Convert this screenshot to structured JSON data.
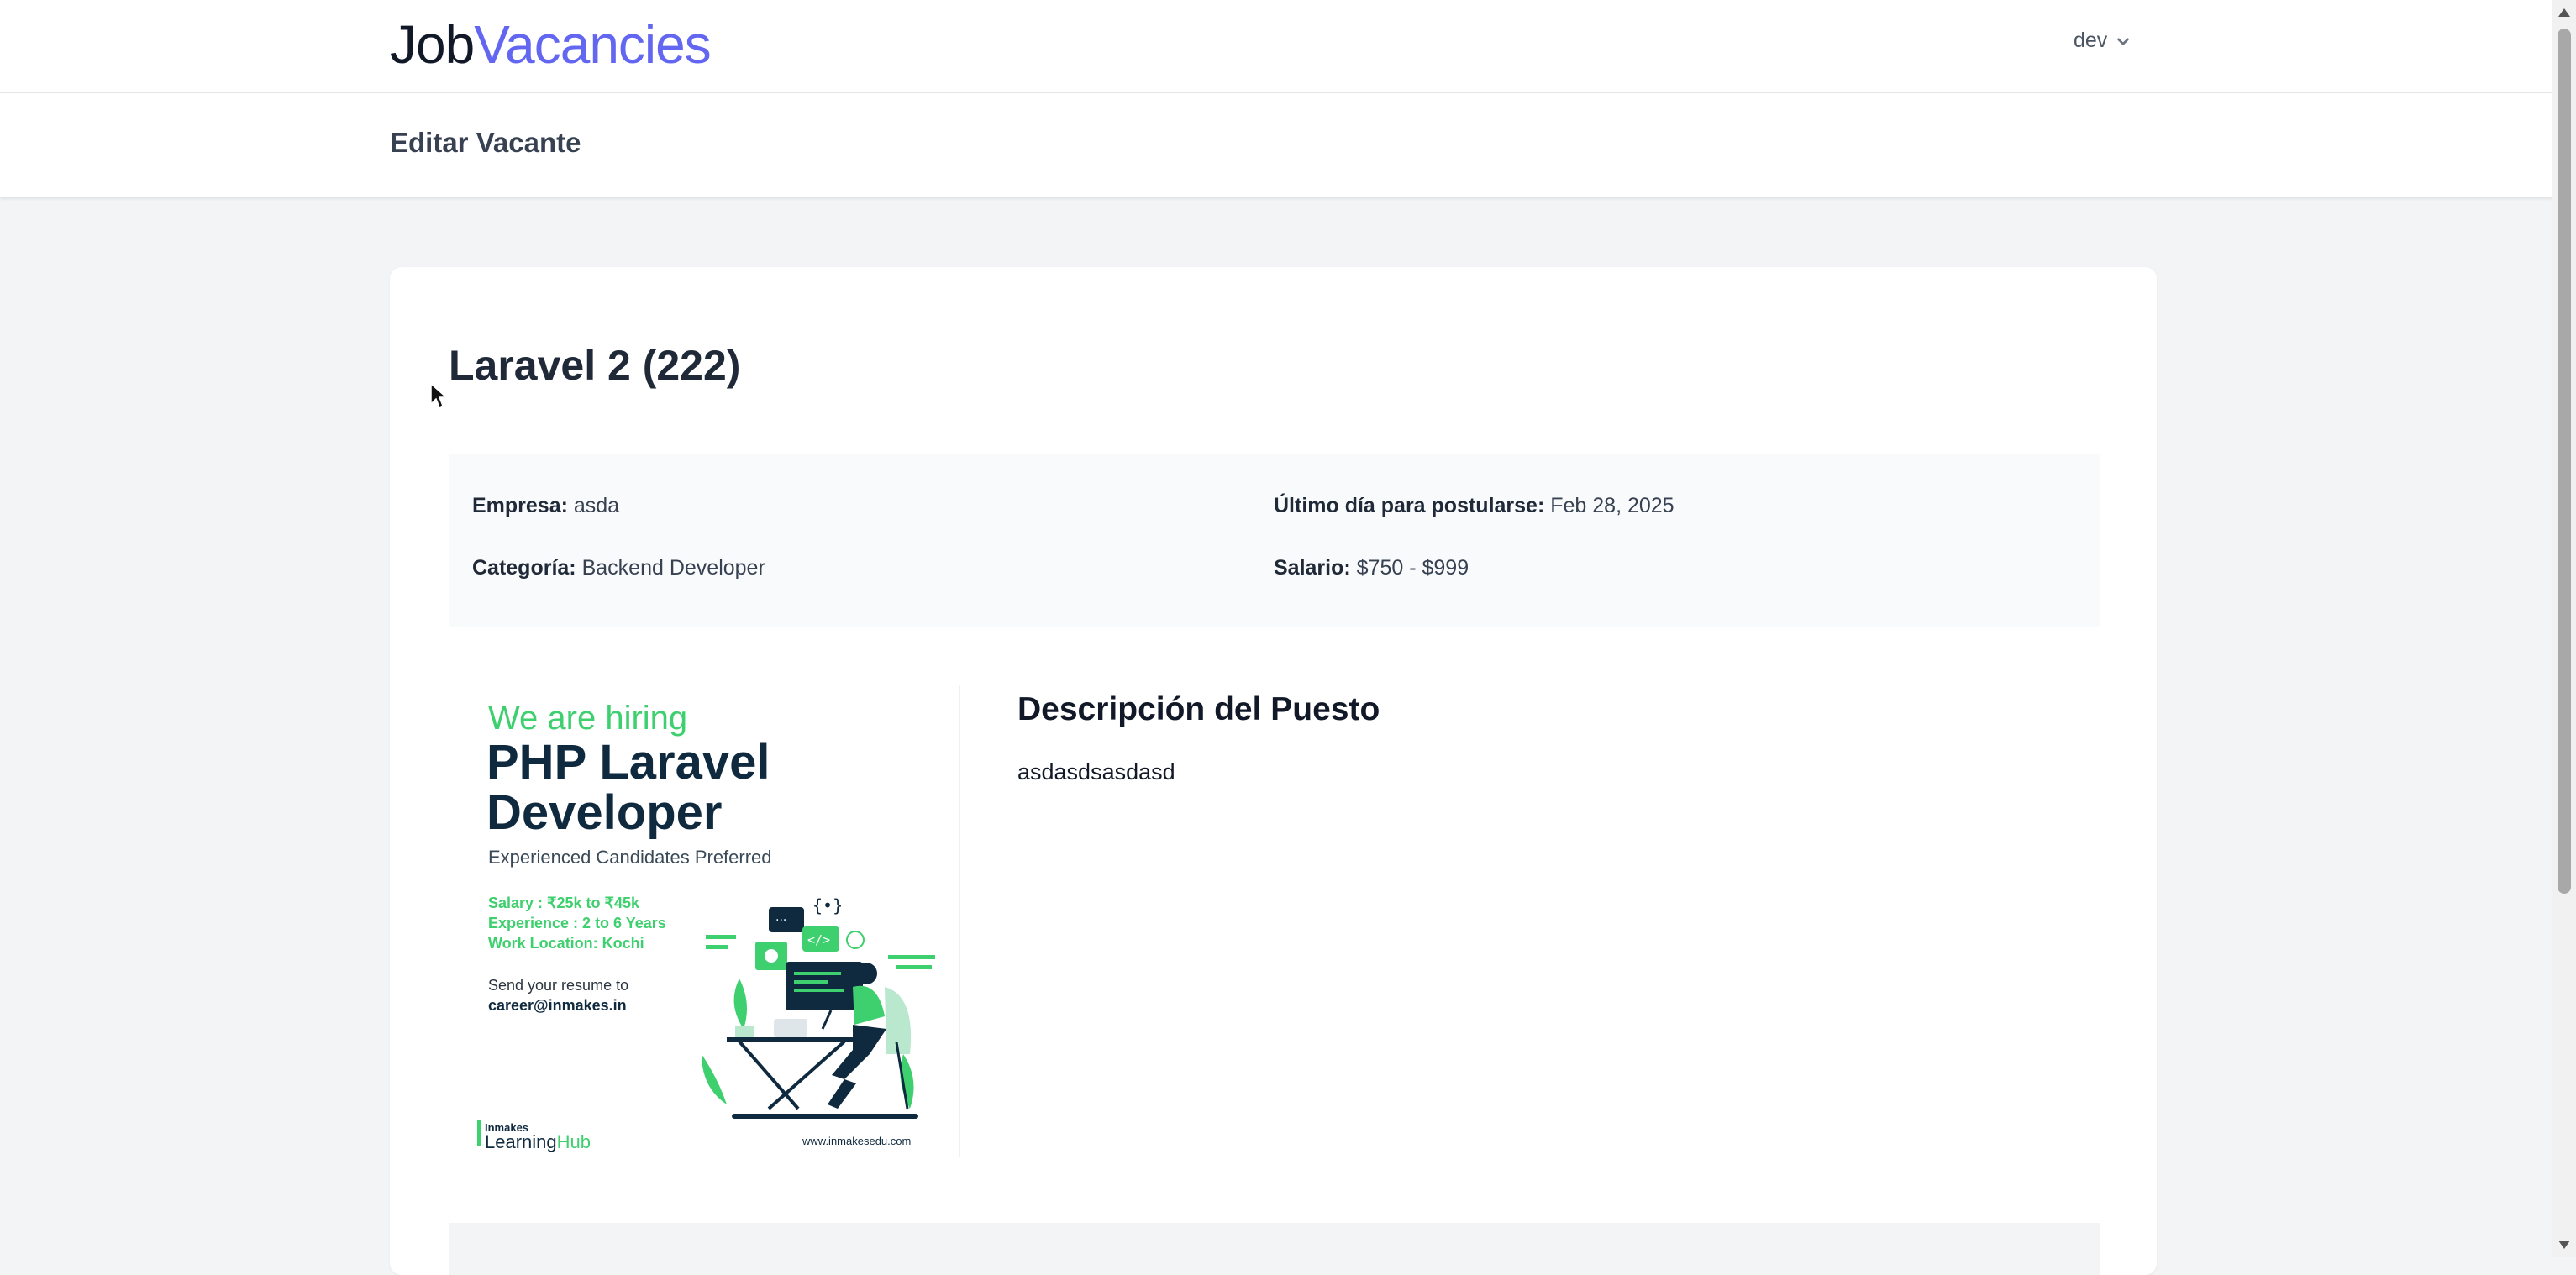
{
  "brand": {
    "part1": "Job",
    "part2": "Vacancies"
  },
  "user_menu": {
    "name": "dev",
    "icon": "chevron-down-icon"
  },
  "page": {
    "title": "Editar Vacante"
  },
  "vacancy": {
    "title": "Laravel 2 (222)",
    "company_label": "Empresa:",
    "company": "asda",
    "deadline_label": "Último día para postularse:",
    "deadline": "Feb 28, 2025",
    "category_label": "Categoría:",
    "category": "Backend Developer",
    "salary_label": "Salario:",
    "salary": "$750 - $999",
    "description_title": "Descripción del Puesto",
    "description": "asdasdsasdasd"
  },
  "poster": {
    "tagline": "We are hiring",
    "title_line1": "PHP Laravel",
    "title_line2": "Developer",
    "subtitle": "Experienced Candidates Preferred",
    "salary": "Salary : ₹25k to ₹45k",
    "experience": "Experience : 2 to 6 Years",
    "location": "Work Location: Kochi",
    "send_text": "Send your resume to",
    "email": "career@inmakes.in",
    "org_line1": "Inmakes",
    "org_line2_a": "Learning",
    "org_line2_b": "Hub",
    "website": "www.inmakesedu.com"
  },
  "colors": {
    "brand_accent": "#6366f1",
    "poster_green": "#3ecf6e",
    "poster_navy": "#0f2a3f",
    "background": "#f3f4f6"
  }
}
